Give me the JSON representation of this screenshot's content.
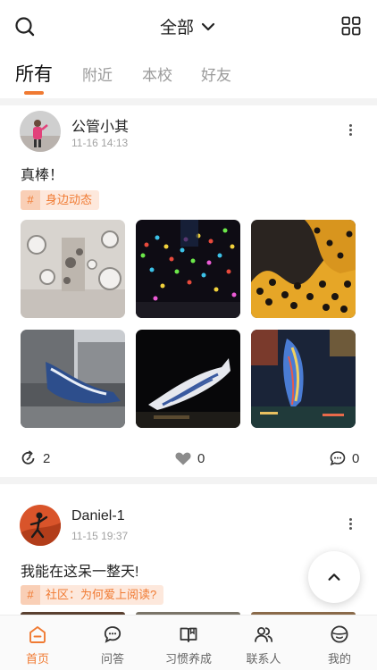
{
  "header": {
    "scope_label": "全部",
    "icons": {
      "search": "search-icon",
      "scope": "chevron-down-icon",
      "layout": "grid-icon"
    }
  },
  "tabs": [
    {
      "label": "所有",
      "active": true
    },
    {
      "label": "附近",
      "active": false
    },
    {
      "label": "本校",
      "active": false
    },
    {
      "label": "好友",
      "active": false
    }
  ],
  "posts": [
    {
      "user_name": "公管小其",
      "timestamp": "11-16 14:13",
      "text": "真棒！",
      "tag_symbol": "#",
      "tag_label": "身边动态",
      "photo_count": 6,
      "reposts": "2",
      "likes": "0",
      "comments": "0"
    },
    {
      "user_name": "Daniel-1",
      "timestamp": "11-15 19:37",
      "text": "我能在这呆一整天!",
      "tag_symbol": "#",
      "tag_label": "社区：为何爱上阅读?",
      "photo_count": 3
    }
  ],
  "bottom_nav": [
    {
      "label": "首页",
      "icon": "home-icon",
      "active": true
    },
    {
      "label": "问答",
      "icon": "chat-bubble-icon",
      "active": false
    },
    {
      "label": "习惯养成",
      "icon": "open-book-icon",
      "active": false
    },
    {
      "label": "联系人",
      "icon": "contacts-icon",
      "active": false
    },
    {
      "label": "我的",
      "icon": "profile-face-icon",
      "active": false
    }
  ],
  "colors": {
    "accent": "#f07a32",
    "tag_bg": "#fde8dc",
    "muted_text": "#a3a3a3"
  }
}
